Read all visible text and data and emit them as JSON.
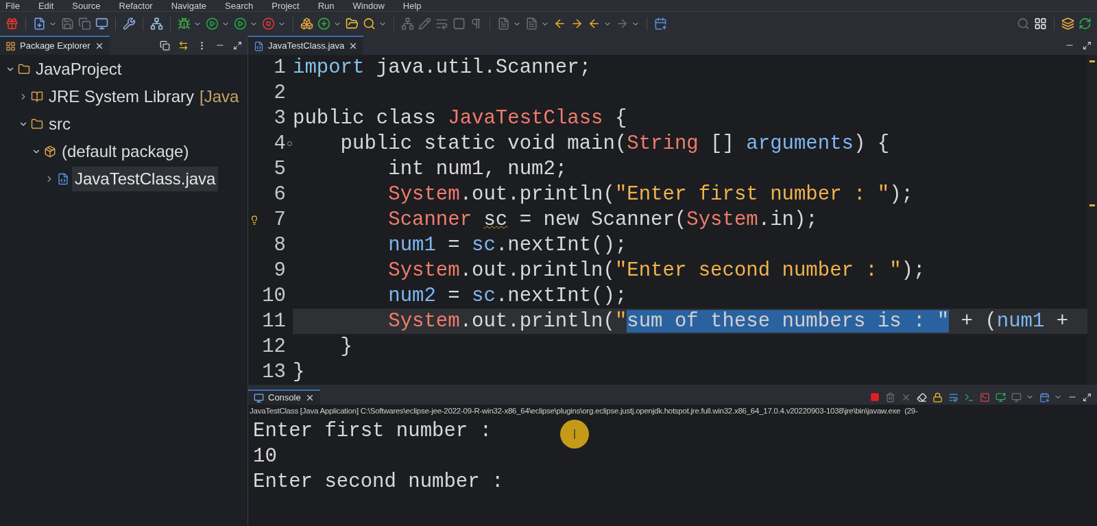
{
  "menu": [
    "File",
    "Edit",
    "Source",
    "Refactor",
    "Navigate",
    "Search",
    "Project",
    "Run",
    "Window",
    "Help"
  ],
  "explorer": {
    "tab": {
      "label": "Package Explorer",
      "selected": true
    },
    "tree": [
      {
        "kind": "project",
        "label": "JavaProject",
        "expanded": true,
        "selected": false,
        "children": [
          {
            "kind": "library",
            "label": "JRE System Library",
            "decoration": "[Java",
            "expanded": false,
            "selected": false
          },
          {
            "kind": "source-folder",
            "label": "src",
            "expanded": true,
            "selected": false,
            "children": [
              {
                "kind": "package",
                "label": "(default package)",
                "expanded": true,
                "selected": false,
                "children": [
                  {
                    "kind": "java-file",
                    "label": "JavaTestClass.java",
                    "expanded": false,
                    "selected": true
                  }
                ]
              }
            ]
          }
        ]
      }
    ]
  },
  "editor": {
    "tab": {
      "label": "JavaTestClass.java",
      "selected": true
    },
    "lines": [
      {
        "number": "1",
        "current": false,
        "tokens": [
          {
            "text": "import",
            "kind": "keyword"
          },
          {
            "text": " java.util.Scanner;",
            "kind": "plain"
          }
        ]
      },
      {
        "number": "2",
        "current": false
      },
      {
        "number": "3",
        "current": false,
        "tokens": [
          {
            "text": "public class ",
            "kind": "plain"
          },
          {
            "text": "JavaTestClass",
            "kind": "type"
          },
          {
            "text": " {",
            "kind": "plain"
          }
        ]
      },
      {
        "number": "4",
        "current": false,
        "fold": true,
        "tokens": [
          {
            "text": "    public static void main(",
            "kind": "plain"
          },
          {
            "text": "String",
            "kind": "type"
          },
          {
            "text": " [] ",
            "kind": "plain"
          },
          {
            "text": "arguments",
            "kind": "variable"
          },
          {
            "text": ") {",
            "kind": "plain"
          }
        ]
      },
      {
        "number": "5",
        "current": false,
        "tokens": [
          {
            "text": "        int num1, num2;",
            "kind": "plain"
          }
        ]
      },
      {
        "number": "6",
        "current": false,
        "tokens": [
          {
            "text": "        System",
            "kind": "type"
          },
          {
            "text": ".out.println(",
            "kind": "plain"
          },
          {
            "text": "\"Enter first number : \"",
            "kind": "string"
          },
          {
            "text": ");",
            "kind": "plain"
          }
        ]
      },
      {
        "number": "7",
        "current": false,
        "hint": true,
        "tokens": [
          {
            "text": "        Scanner ",
            "kind": "type"
          },
          {
            "text": "sc",
            "kind": "plain",
            "warning": true
          },
          {
            "text": " = new Scanner(",
            "kind": "plain"
          },
          {
            "text": "System",
            "kind": "type"
          },
          {
            "text": ".in);",
            "kind": "plain"
          }
        ]
      },
      {
        "number": "8",
        "current": false,
        "tokens": [
          {
            "text": "        num1",
            "kind": "variable"
          },
          {
            "text": " = ",
            "kind": "plain"
          },
          {
            "text": "sc",
            "kind": "variable"
          },
          {
            "text": ".nextInt();",
            "kind": "plain"
          }
        ]
      },
      {
        "number": "9",
        "current": false,
        "tokens": [
          {
            "text": "        System",
            "kind": "type"
          },
          {
            "text": ".out.println(",
            "kind": "plain"
          },
          {
            "text": "\"Enter second number : \"",
            "kind": "string"
          },
          {
            "text": ");",
            "kind": "plain"
          }
        ]
      },
      {
        "number": "10",
        "current": false,
        "tokens": [
          {
            "text": "        num2",
            "kind": "variable"
          },
          {
            "text": " = ",
            "kind": "plain"
          },
          {
            "text": "sc",
            "kind": "variable"
          },
          {
            "text": ".nextInt();",
            "kind": "plain"
          }
        ]
      },
      {
        "number": "11",
        "current": true,
        "tokens": [
          {
            "text": "        System",
            "kind": "type"
          },
          {
            "text": ".out.println(",
            "kind": "plain"
          },
          {
            "text": "\"",
            "kind": "string"
          },
          {
            "text": "sum of these numbers is : \"",
            "kind": "string",
            "selected": true
          },
          {
            "text": " + (",
            "kind": "plain"
          },
          {
            "text": "num1",
            "kind": "variable"
          },
          {
            "text": " +",
            "kind": "plain"
          }
        ]
      },
      {
        "number": "12",
        "current": false,
        "tokens": [
          {
            "text": "    }",
            "kind": "plain"
          }
        ]
      },
      {
        "number": "13",
        "current": false,
        "tokens": [
          {
            "text": "}",
            "kind": "plain"
          }
        ]
      }
    ]
  },
  "console": {
    "tab": {
      "label": "Console",
      "selected": true
    },
    "launch": "JavaTestClass [Java Application] C:\\Softwares\\eclipse-jee-2022-09-R-win32-x86_64\\eclipse\\plugins\\org.eclipse.justj.openjdk.hotspot.jre.full.win32.x86_64_17.0.4.v20220903-1038\\jre\\bin\\javaw.exe  (29-",
    "output": [
      "Enter first number :",
      "10",
      "Enter second number :"
    ]
  }
}
